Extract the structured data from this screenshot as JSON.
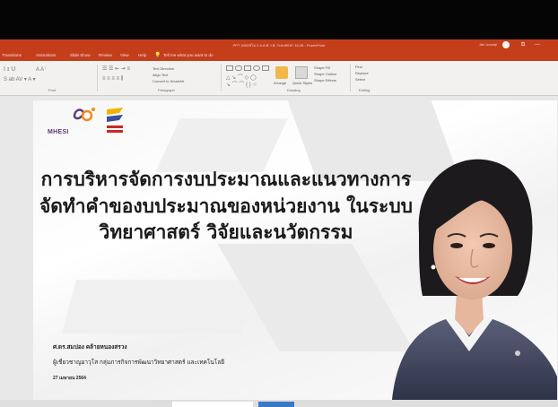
{
  "window": {
    "title": "PPT งบพรสไม 2 ม.ค.ศ.ว.ศ. ระยะศกษา 16.06 - PowerPoint",
    "user": "Jan Uncatp",
    "controls": {
      "restore": "⧉",
      "minimize": "—"
    }
  },
  "ribbon": {
    "tabs": [
      "Transitions",
      "Animations",
      "Slide Show",
      "Review",
      "View",
      "Help",
      "Tell me what you want to do"
    ],
    "groups": {
      "font": "Font",
      "paragraph": "Paragraph",
      "drawing": "Drawing",
      "editing": "Editing"
    },
    "paragraph_items": [
      "Text Direction",
      "Align Text",
      "Convert to SmartArt"
    ],
    "drawing_items": [
      "Arrange",
      "Quick Styles",
      "Shape Fill",
      "Shape Outline",
      "Shape Effects"
    ],
    "editing_items": [
      "Find",
      "Replace",
      "Select"
    ]
  },
  "slide": {
    "logo_text": "MHESI",
    "title_lines": [
      "การบริหารจัดการงบประมาณและแนวทางการ",
      "จัดทำคำของบประมาณของหน่วยงาน ในระบบ",
      "วิทยาศาสตร์ วิจัยและนวัตกรรม"
    ],
    "presenter_name": "ศ.ดร.สมปอง คล้ายหนองสรวง",
    "presenter_role": "ผู้เชี่ยวชาญอาวุโส กลุ่มภารกิจการพัฒนาวิทยาศาสตร์ และเทคโนโลยี",
    "date": "27 เมษายน 2564"
  },
  "colors": {
    "ribbon_accent": "#c43e1c",
    "ribbon_bg": "#f2f1f0",
    "slide_bg": "#f7f7f7",
    "title_text": "#1a1a1a",
    "logo_purple": "#5a3a7a",
    "logo_orange": "#f08a1c"
  }
}
